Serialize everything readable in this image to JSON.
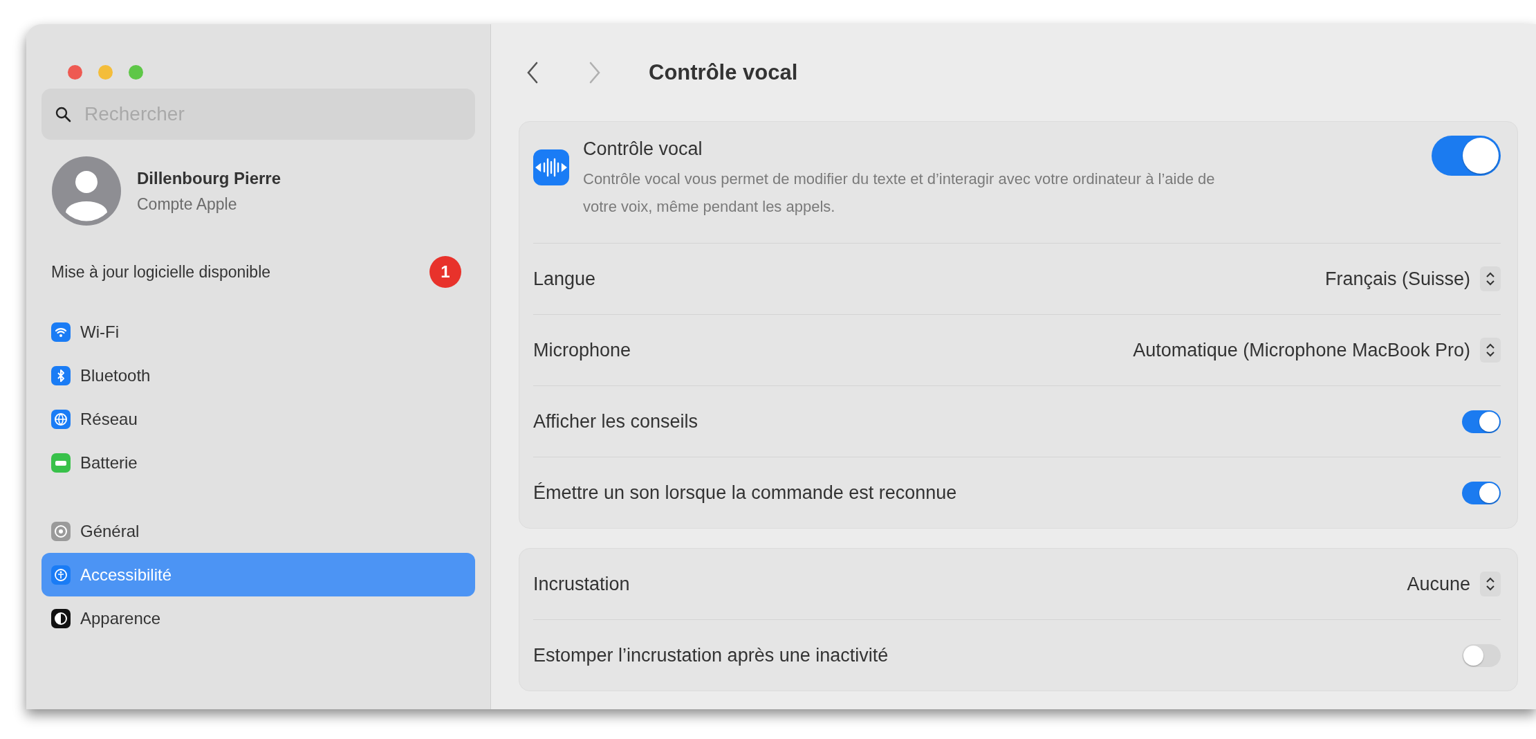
{
  "sidebar": {
    "search": {
      "placeholder": "Rechercher"
    },
    "account": {
      "name": "Dillenbourg Pierre",
      "subtitle": "Compte Apple"
    },
    "update": {
      "label": "Mise à jour logicielle disponible",
      "badge": "1"
    },
    "groups": [
      {
        "items": [
          {
            "label": "Wi-Fi",
            "kind": "wifi",
            "color": "#1a7cf5",
            "selected": false
          },
          {
            "label": "Bluetooth",
            "kind": "bluetooth",
            "color": "#1a7cf5",
            "selected": false
          },
          {
            "label": "Réseau",
            "kind": "globe",
            "color": "#1a7cf5",
            "selected": false
          },
          {
            "label": "Batterie",
            "kind": "battery",
            "color": "#38c14a",
            "selected": false
          }
        ]
      },
      {
        "items": [
          {
            "label": "Général",
            "kind": "gear",
            "color": "#9a9a9a",
            "selected": false
          },
          {
            "label": "Accessibilité",
            "kind": "accessibility",
            "color": "#1a7cf5",
            "selected": true
          },
          {
            "label": "Apparence",
            "kind": "appearance",
            "color": "#111111",
            "selected": false
          }
        ]
      }
    ]
  },
  "main": {
    "title": "Contrôle vocal",
    "sections": [
      {
        "rows": [
          {
            "kind": "feature",
            "title": "Contrôle vocal",
            "description": "Contrôle vocal vous permet de modifier du texte et d’interagir avec votre ordinateur à l’aide de votre voix, même pendant les appels.",
            "on": true
          },
          {
            "kind": "popup",
            "label": "Langue",
            "value": "Français (Suisse)"
          },
          {
            "kind": "popup",
            "label": "Microphone",
            "value": "Automatique (Microphone MacBook Pro)"
          },
          {
            "kind": "toggle",
            "label": "Afficher les conseils",
            "on": true
          },
          {
            "kind": "toggle",
            "label": "Émettre un son lorsque la commande est reconnue",
            "on": true
          }
        ]
      },
      {
        "rows": [
          {
            "kind": "popup",
            "label": "Incrustation",
            "value": "Aucune"
          },
          {
            "kind": "toggle",
            "label": "Estomper l’incrustation après une inactivité",
            "on": false
          }
        ]
      }
    ]
  }
}
